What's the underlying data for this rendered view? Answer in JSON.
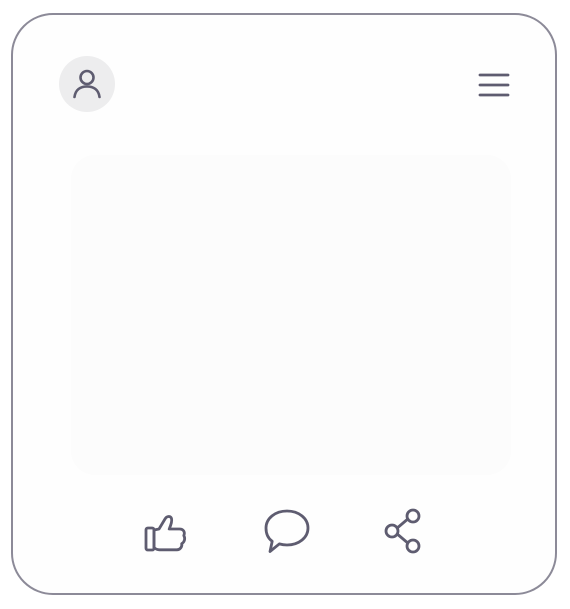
{
  "card": {
    "avatar": {
      "icon": "user-icon"
    },
    "menu": {
      "icon": "hamburger-menu-icon"
    },
    "actions": [
      {
        "name": "like",
        "icon": "thumbs-up-icon"
      },
      {
        "name": "comment",
        "icon": "speech-bubble-icon"
      },
      {
        "name": "share",
        "icon": "share-icon"
      }
    ]
  },
  "colors": {
    "border": "#8c8a98",
    "icon": "#5e5c70",
    "avatar_background": "#ededee",
    "card_background": "#fefefe"
  }
}
